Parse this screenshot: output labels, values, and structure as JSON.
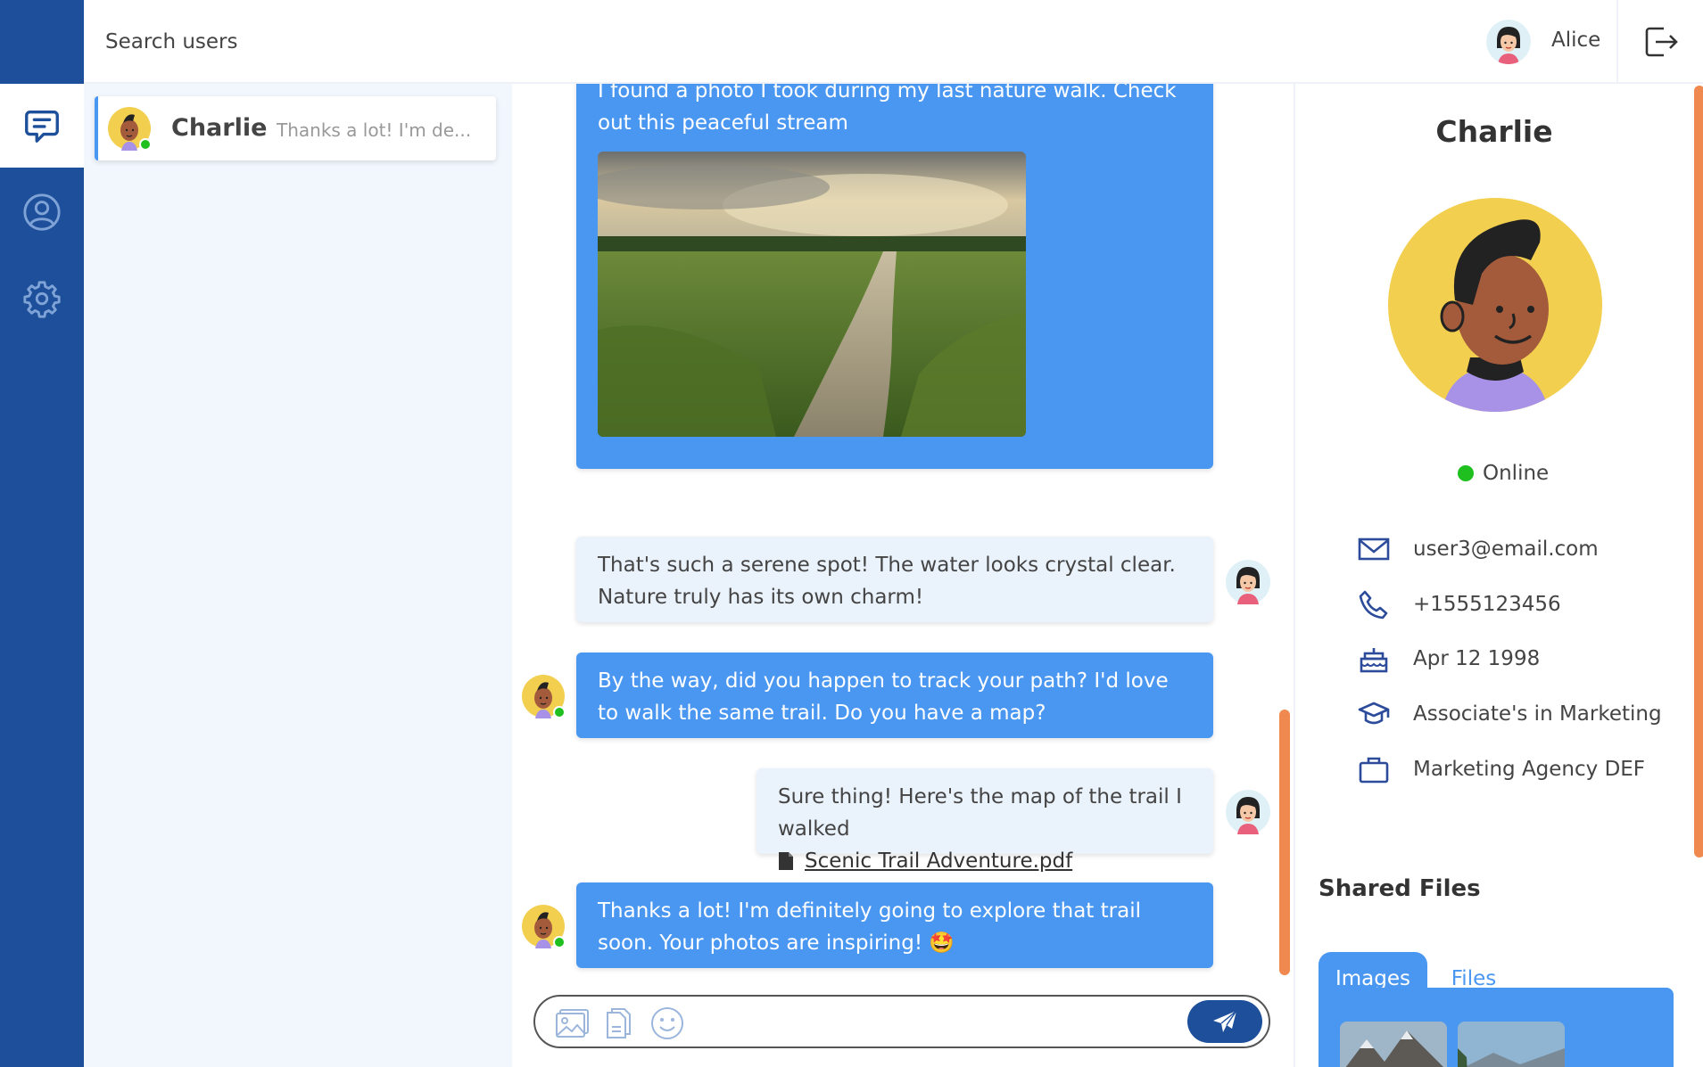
{
  "search": {
    "placeholder": "Search users"
  },
  "current_user": {
    "name": "Alice"
  },
  "nav": {
    "items": [
      "chat-icon",
      "profile-icon",
      "gear-icon"
    ],
    "active": "chat-icon"
  },
  "conversations": [
    {
      "name": "Charlie",
      "preview": "Thanks a lot! I'm de...",
      "online": true
    }
  ],
  "messages": [
    {
      "from": "Charlie",
      "text": "I found a photo I took during my last nature walk. Check out this peaceful stream",
      "has_photo": true
    },
    {
      "from": "Alice",
      "text": "That's such a serene spot! The water looks crystal clear. Nature truly has its own charm!"
    },
    {
      "from": "Charlie",
      "text": "By the way, did you happen to track your path? I'd love to walk the same trail. Do you have a map?"
    },
    {
      "from": "Alice",
      "text": "Sure thing! Here's the map of the trail I walked",
      "attachment": "Scenic Trail Adventure.pdf"
    },
    {
      "from": "Charlie",
      "text": "Thanks a lot! I'm definitely going to explore that trail soon. Your photos are inspiring! 🤩"
    }
  ],
  "composer": {
    "placeholder": ""
  },
  "profile": {
    "name": "Charlie",
    "status": "Online",
    "email": "user3@email.com",
    "phone": "+1555123456",
    "birthday": "Apr 12 1998",
    "education": "Associate's in Marketing",
    "work": "Marketing Agency DEF",
    "shared_title": "Shared Files",
    "tabs": [
      "Images",
      "Files"
    ],
    "active_tab": "Images"
  },
  "colors": {
    "rail": "#1d4f9a",
    "accent": "#4a97f2",
    "online": "#1fbf1f",
    "scrollbar": "#f0894f"
  }
}
